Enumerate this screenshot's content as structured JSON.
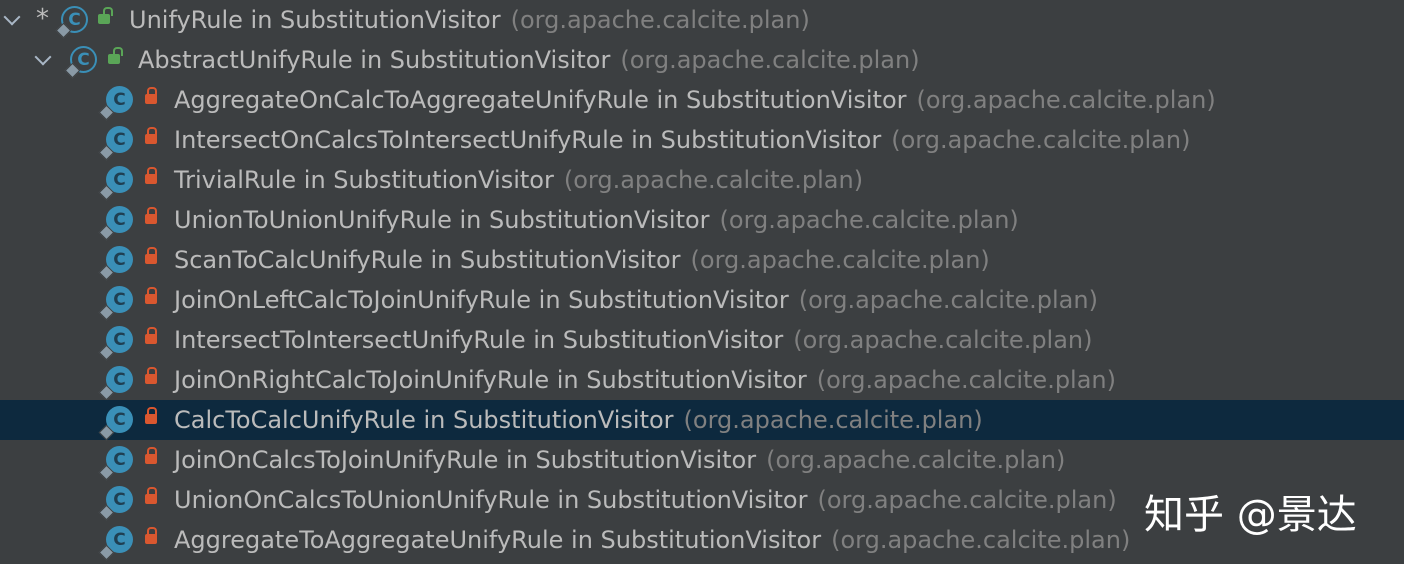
{
  "tree": {
    "root": {
      "prefix": "*",
      "name": "UnifyRule in SubstitutionVisitor",
      "package": "(org.apache.calcite.plan)"
    },
    "parent": {
      "name": "AbstractUnifyRule in SubstitutionVisitor",
      "package": "(org.apache.calcite.plan)"
    },
    "children": [
      {
        "name": "AggregateOnCalcToAggregateUnifyRule in SubstitutionVisitor",
        "package": "(org.apache.calcite.plan)"
      },
      {
        "name": "IntersectOnCalcsToIntersectUnifyRule in SubstitutionVisitor",
        "package": "(org.apache.calcite.plan)"
      },
      {
        "name": "TrivialRule in SubstitutionVisitor",
        "package": "(org.apache.calcite.plan)"
      },
      {
        "name": "UnionToUnionUnifyRule in SubstitutionVisitor",
        "package": "(org.apache.calcite.plan)"
      },
      {
        "name": "ScanToCalcUnifyRule in SubstitutionVisitor",
        "package": "(org.apache.calcite.plan)"
      },
      {
        "name": "JoinOnLeftCalcToJoinUnifyRule in SubstitutionVisitor",
        "package": "(org.apache.calcite.plan)"
      },
      {
        "name": "IntersectToIntersectUnifyRule in SubstitutionVisitor",
        "package": "(org.apache.calcite.plan)"
      },
      {
        "name": "JoinOnRightCalcToJoinUnifyRule in SubstitutionVisitor",
        "package": "(org.apache.calcite.plan)"
      },
      {
        "name": "CalcToCalcUnifyRule in SubstitutionVisitor",
        "package": "(org.apache.calcite.plan)"
      },
      {
        "name": "JoinOnCalcsToJoinUnifyRule in SubstitutionVisitor",
        "package": "(org.apache.calcite.plan)"
      },
      {
        "name": "UnionOnCalcsToUnionUnifyRule in SubstitutionVisitor",
        "package": "(org.apache.calcite.plan)"
      },
      {
        "name": "AggregateToAggregateUnifyRule in SubstitutionVisitor",
        "package": "(org.apache.calcite.plan)"
      }
    ],
    "selected_index": 8
  },
  "icons": {
    "class_icon_letter": "C",
    "class_icon_color": "#3a8fb7",
    "open_lock_color": "#5aa557",
    "closed_lock_color": "#d9572f",
    "selection_color": "#0d293e"
  },
  "watermark": "知乎 @景达"
}
